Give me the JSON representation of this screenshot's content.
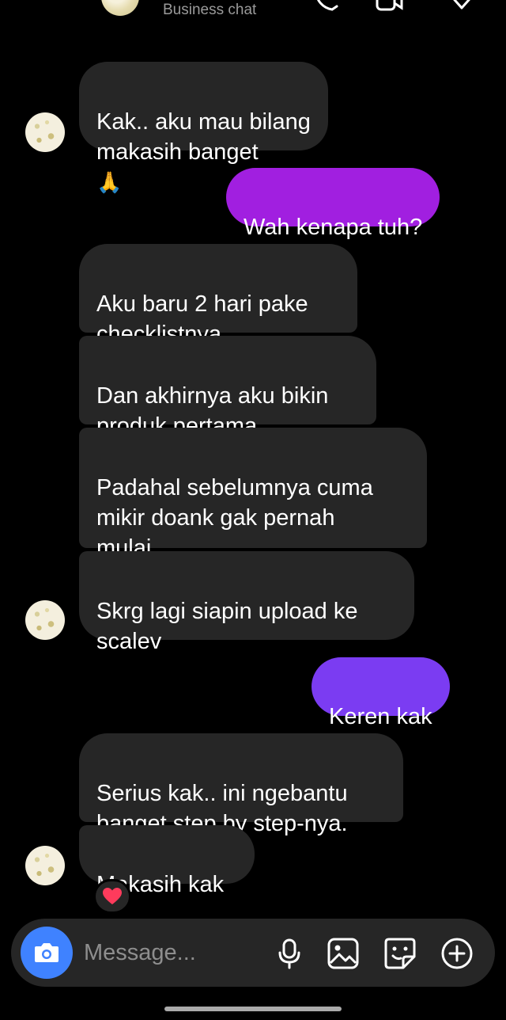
{
  "header": {
    "subtitle": "Business chat"
  },
  "messages": [
    {
      "direction": "in",
      "text": "Kak.. aku mau bilang\nmakasih banget",
      "emoji": "🙏"
    },
    {
      "direction": "out",
      "text": "Wah kenapa tuh?",
      "emoji": "☺️"
    },
    {
      "direction": "in",
      "text": "Aku baru 2 hari pake\nchecklistnya",
      "emoji": ""
    },
    {
      "direction": "in",
      "text": "Dan akhirnya aku bikin\nproduk pertama",
      "emoji": "😊"
    },
    {
      "direction": "in",
      "text": "Padahal sebelumnya cuma\nmikir doank gak pernah\nmulai",
      "emoji": ""
    },
    {
      "direction": "in",
      "text": "Skrg lagi siapin upload ke\nscalev",
      "emoji": ""
    },
    {
      "direction": "out",
      "text": "Keren kak",
      "emoji": "👍"
    },
    {
      "direction": "in",
      "text": "Serius kak.. ini ngebantu\nbanget step by step-nya.",
      "emoji": ""
    },
    {
      "direction": "in",
      "text": "Makasih kak",
      "emoji": ""
    }
  ],
  "reaction": {
    "emoji": "❤️"
  },
  "composer": {
    "placeholder": "Message..."
  },
  "colors": {
    "incoming_bubble": "#262626",
    "outgoing_purple": "#a11fe0",
    "outgoing_violet": "#7b3cf2",
    "camera_button": "#3f82ff"
  },
  "icons": [
    "back-arrow-icon",
    "phone-icon",
    "video-icon",
    "tag-icon",
    "camera-icon",
    "microphone-icon",
    "gallery-icon",
    "sticker-icon",
    "plus-icon"
  ]
}
